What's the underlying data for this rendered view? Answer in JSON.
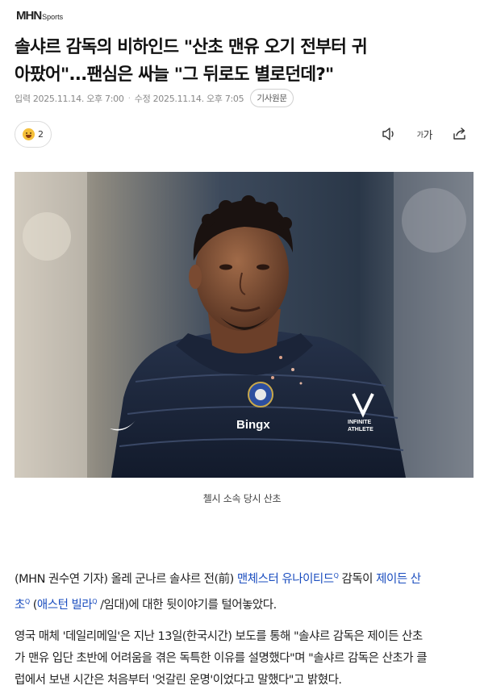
{
  "site": {
    "logo_main": "MHN",
    "logo_sub": "Sports"
  },
  "article": {
    "headline_line1": "솔샤르 감독의 비하인드 \"산초 맨유 오기 전부터 귀",
    "headline_line2": "아팠어\"...팬심은 싸늘 \"그 뒤로도 별로던데?\"",
    "published": "입력 2025.11.14. 오후 7:00",
    "modified": "수정 2025.11.14. 오후 7:05",
    "original_button": "기사원문",
    "reaction_count": "2",
    "reaction_icon": "grinning-face-icon",
    "tools": {
      "audio_icon": "speaker-icon",
      "font_small": "가",
      "font_large": "가",
      "share_icon": "share-icon"
    },
    "photo_caption": "첼시 소속 당시 산초",
    "photo_text": {
      "sponsor": "Bingx",
      "brand_line1": "INFINITE",
      "brand_line2": "ATHLETE"
    },
    "p1": {
      "a": "(MHN 권수연 기자) 올레 군나르 솔샤르 전(前) ",
      "link1": "맨체스터 유나이티드",
      "b": "  감독이 ",
      "link2a": "제이든 산",
      "link2b": "초",
      "c": " (",
      "link3": "애스턴 빌라",
      "d": " /임대)에 대한 뒷이야기를 털어놓았다.",
      "link_marker": "Q"
    },
    "p2": {
      "line1": "영국 매체 '데일리메일'은 지난 13일(한국시간) 보도를 통해 \"솔샤르 감독은 제이든 산초",
      "line2": "가 맨유 입단 초반에 어려움을 겪은 독특한 이유를 설명했다\"며 \"솔샤르 감독은 산초가 클",
      "line3": "럽에서 보낸 시간은 처음부터 '엇갈린 운명'이었다고 말했다\"고 밝혔다."
    }
  },
  "colors": {
    "link": "#1a4dbf",
    "text": "#222222",
    "meta": "#888888"
  }
}
